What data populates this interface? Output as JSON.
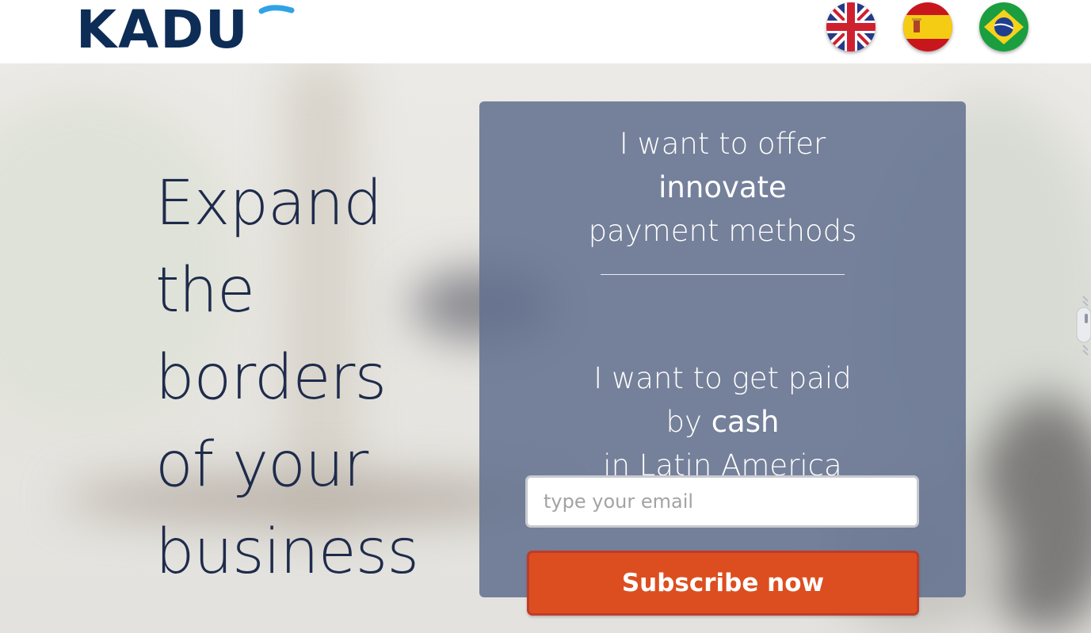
{
  "brand": {
    "logo_text": "KADU",
    "logo_color": "#0d2d57",
    "logo_accent": "#2fa3e6"
  },
  "languages": [
    {
      "name": "uk-flag-icon"
    },
    {
      "name": "spain-flag-icon"
    },
    {
      "name": "brazil-flag-icon"
    }
  ],
  "hero": {
    "headline": [
      "Expand",
      "the",
      "borders",
      "of your",
      "business"
    ],
    "headline_color": "#1e2b4b"
  },
  "panel": {
    "offer_line1": "I want to offer",
    "offer_line2": "innovate",
    "offer_line3": "payment methods",
    "paid_line1": "I want to get paid",
    "paid_line2_prefix": "by ",
    "paid_line2_em": "cash",
    "paid_line3": "in Latin America",
    "email_placeholder": "type your email",
    "subscribe_label": "Subscribe now",
    "button_color": "#dc4e1f"
  }
}
